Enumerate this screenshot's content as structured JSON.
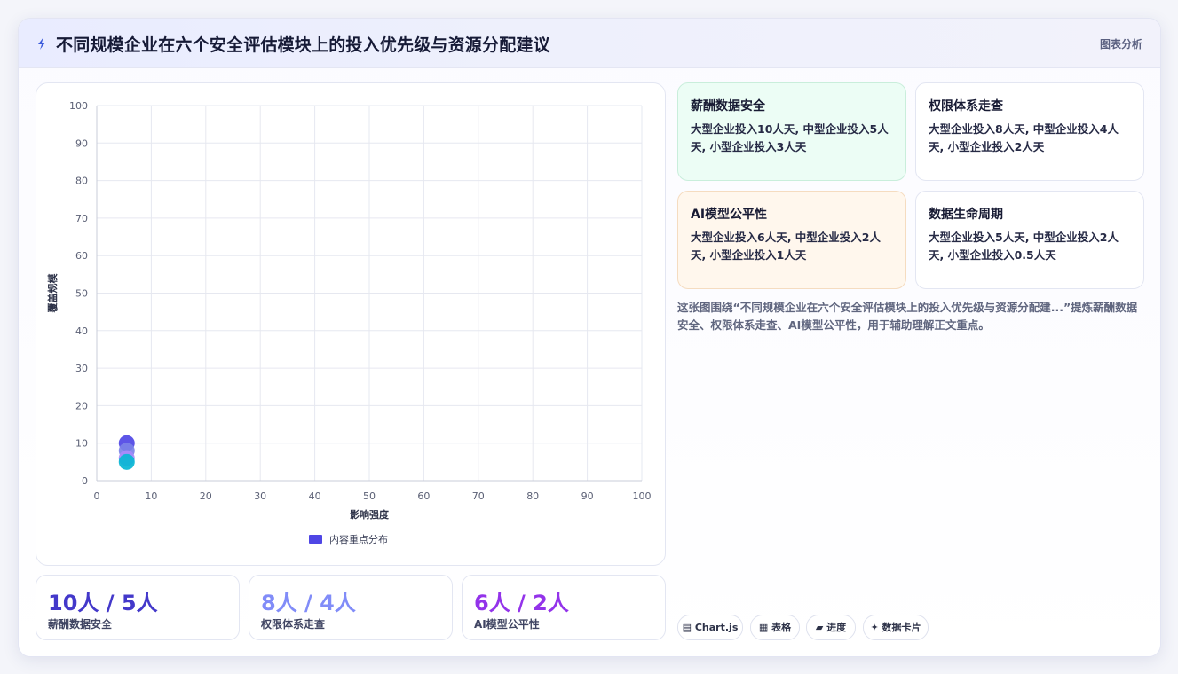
{
  "header": {
    "title": "不同规模企业在六个安全评估模块上的投入优先级与资源分配建议",
    "tag": "图表分析"
  },
  "chart_data": {
    "type": "scatter",
    "xlabel": "影响强度",
    "ylabel": "覆盖规模",
    "xlim": [
      0,
      100
    ],
    "ylim": [
      0,
      100
    ],
    "xticks": [
      "0",
      "10",
      "20",
      "30",
      "40",
      "50",
      "60",
      "70",
      "80",
      "90",
      "100"
    ],
    "yticks": [
      "0",
      "10",
      "20",
      "30",
      "40",
      "50",
      "60",
      "70",
      "80",
      "90",
      "100"
    ],
    "grid": true,
    "legend_position": "bottom",
    "series": [
      {
        "name": "内容重点分布",
        "points": [
          {
            "x": 5.5,
            "y": 10
          },
          {
            "x": 5.5,
            "y": 8
          },
          {
            "x": 5.5,
            "y": 6
          },
          {
            "x": 5.5,
            "y": 5
          }
        ],
        "colors": [
          "#4f46e5",
          "#7c83e8",
          "#a78bfa",
          "#06b6d4"
        ]
      }
    ]
  },
  "stats": [
    {
      "value": "10人 / 5人",
      "label": "薪酬数据安全",
      "color": "#4338ca"
    },
    {
      "value": "8人 / 4人",
      "label": "权限体系走查",
      "color": "#818cf8"
    },
    {
      "value": "6人 / 2人",
      "label": "AI模型公平性",
      "color": "#9333ea"
    }
  ],
  "modules": [
    {
      "title": "薪酬数据安全",
      "desc": "大型企业投入10人天, 中型企业投入5人天, 小型企业投入3人天",
      "bg": "#ecfdf5",
      "border": "#c9eedb"
    },
    {
      "title": "权限体系走查",
      "desc": "大型企业投入8人天, 中型企业投入4人天, 小型企业投入2人天",
      "bg": "#ffffff",
      "border": "#e3e6f2"
    },
    {
      "title": "AI模型公平性",
      "desc": "大型企业投入6人天, 中型企业投入2人天, 小型企业投入1人天",
      "bg": "#fff7ed",
      "border": "#f5dcc0"
    },
    {
      "title": "数据生命周期",
      "desc": "大型企业投入5人天, 中型企业投入2人天, 小型企业投入0.5人天",
      "bg": "#ffffff",
      "border": "#e3e6f2"
    }
  ],
  "summary": "这张图围绕“不同规模企业在六个安全评估模块上的投入优先级与资源分配建...”提炼薪酬数据安全、权限体系走查、AI模型公平性，用于辅助理解正文重点。",
  "chips": [
    {
      "icon": "▤",
      "label": "Chart.js"
    },
    {
      "icon": "▦",
      "label": "表格"
    },
    {
      "icon": "▰",
      "label": "进度"
    },
    {
      "icon": "✦",
      "label": "数据卡片"
    }
  ],
  "colors": {
    "accent": "#4f46e5",
    "grid": "#e6e8f0",
    "axis": "#5b6075"
  }
}
